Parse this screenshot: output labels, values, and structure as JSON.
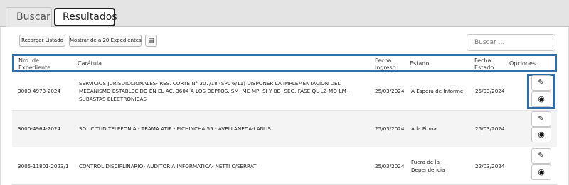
{
  "tabs": [
    {
      "label": "Buscar"
    },
    {
      "label": "Resultados"
    }
  ],
  "toolbar": {
    "reload_label": "Recargar Listado",
    "show_label": "Mostrar de a 20 Expedientes",
    "export_icon": "document-icon",
    "export_glyph": "▤"
  },
  "search": {
    "placeholder": "Buscar ..."
  },
  "table": {
    "headers": {
      "nro": "Nro. de Expediente",
      "caratula": "Carátula",
      "fecha_ingreso": "Fecha Ingreso",
      "estado": "Estado",
      "fecha_estado": "Fecha Estado",
      "opciones": "Opciones"
    },
    "rows": [
      {
        "nro": "3000-4973-2024",
        "caratula": "SERVICIOS JURISDICCIONALES- RES. CORTE N° 307/18 (SPL 6/11) DISPONER LA IMPLEMENTACION DEL MECANISMO ESTABLECIDO EN EL AC. 3604 A LOS DEPTOS. SM- ME-MP- SI Y BB- SEG. FASE QL-LZ-MO-LM-SUBASTAS ELECTRONICAS",
        "fecha_ingreso": "25/03/2024",
        "estado": "A Espera de Informe",
        "fecha_estado": "25/03/2024"
      },
      {
        "nro": "3000-4964-2024",
        "caratula": "SOLICITUD TELEFONIA - TRAMA ATIP - PICHINCHA 55 - AVELLANEDA-LANUS",
        "fecha_ingreso": "25/03/2024",
        "estado": "A la Firma",
        "fecha_estado": "25/03/2024"
      },
      {
        "nro": "3005-11801-2023/1",
        "caratula": "CONTROL DISCIPLINARIO- AUDITORIA INFORMATICA- NETTI C/SERRAT",
        "fecha_ingreso": "25/03/2024",
        "estado": "Fuera de la Dependencia",
        "fecha_estado": "22/03/2024"
      }
    ]
  },
  "icons": {
    "edit": {
      "name": "pencil-icon",
      "glyph": "✎"
    },
    "view": {
      "name": "eye-icon",
      "glyph": "◉"
    }
  },
  "colors": {
    "highlight": "#2e6fa7",
    "tabbar": "#e4e4e4",
    "alt_row": "#f4f4f4"
  }
}
